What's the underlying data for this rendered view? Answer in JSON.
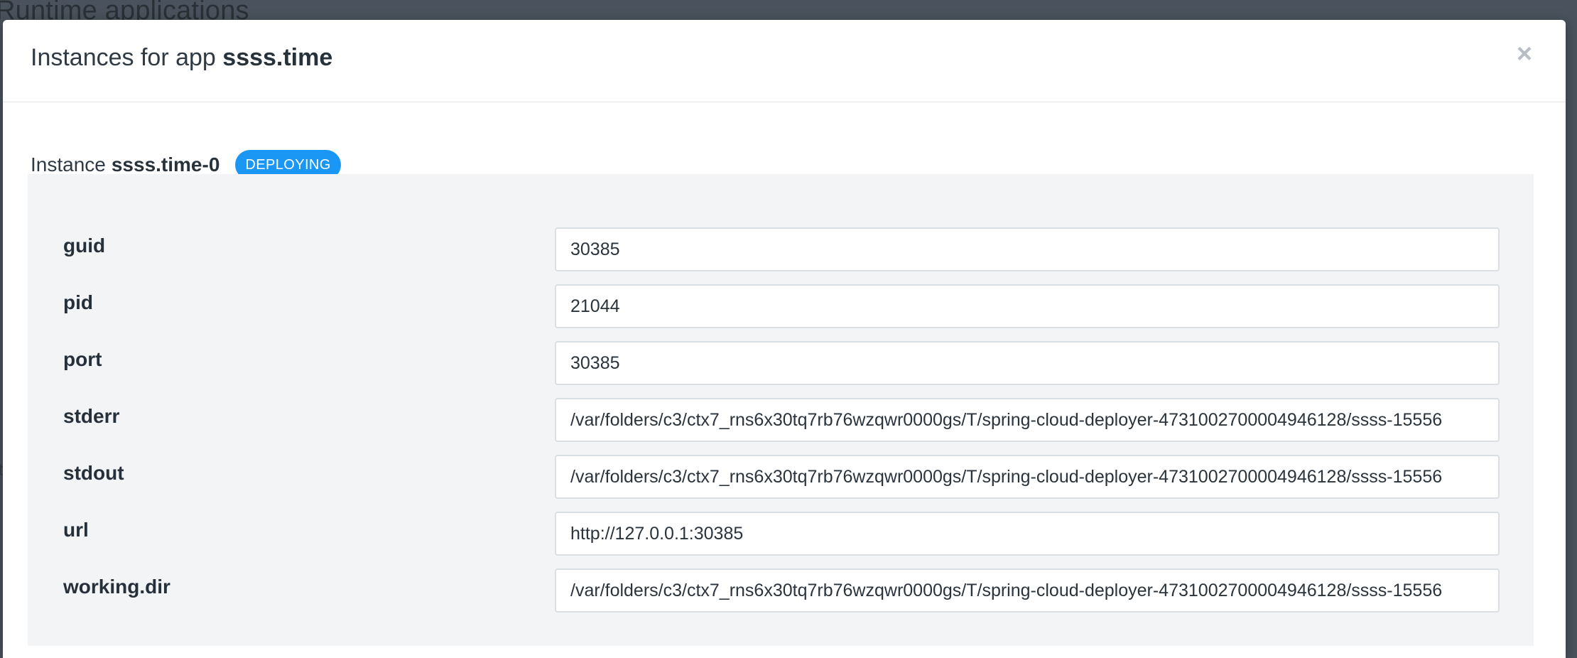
{
  "backdrop": {
    "page_title": "Runtime applications",
    "left_mark": "t"
  },
  "modal": {
    "title_prefix": "Instances for app",
    "app_name": "ssss.time",
    "close_glyph": "×"
  },
  "instance": {
    "label": "Instance",
    "id": "ssss.time-0",
    "status": "DEPLOYING",
    "status_color": "#1a97f5"
  },
  "properties": [
    {
      "label": "guid",
      "value": "30385"
    },
    {
      "label": "pid",
      "value": "21044"
    },
    {
      "label": "port",
      "value": "30385"
    },
    {
      "label": "stderr",
      "value": "/var/folders/c3/ctx7_rns6x30tq7rb76wzqwr0000gs/T/spring-cloud-deployer-4731002700004946128/ssss-15556"
    },
    {
      "label": "stdout",
      "value": "/var/folders/c3/ctx7_rns6x30tq7rb76wzqwr0000gs/T/spring-cloud-deployer-4731002700004946128/ssss-15556"
    },
    {
      "label": "url",
      "value": "http://127.0.0.1:30385"
    },
    {
      "label": "working.dir",
      "value": "/var/folders/c3/ctx7_rns6x30tq7rb76wzqwr0000gs/T/spring-cloud-deployer-4731002700004946128/ssss-15556"
    }
  ]
}
